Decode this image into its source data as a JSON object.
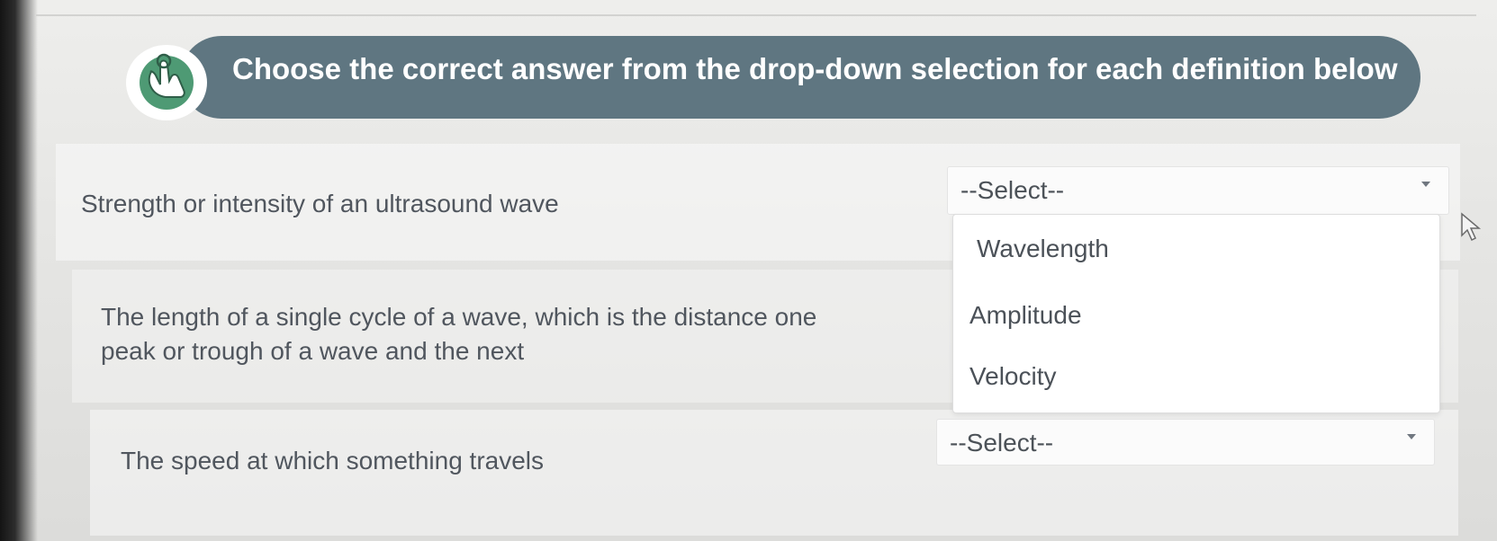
{
  "instructions": {
    "title": "Choose the correct answer from the drop-down selection for each definition below",
    "icon": "hand-pointer-icon"
  },
  "questions": [
    {
      "definition": "Strength or intensity of an ultrasound wave",
      "selected": "--Select--",
      "open": true,
      "options": [
        "Wavelength",
        "Amplitude",
        "Velocity"
      ]
    },
    {
      "definition": "The length of a single cycle of a wave, which is the distance one peak or trough of a wave and the next"
    },
    {
      "definition": "The speed at which something travels",
      "selected": "--Select--",
      "open": false
    }
  ],
  "colors": {
    "banner": "#5f7681",
    "icon_green": "#4e9a74",
    "text": "#50565e"
  }
}
